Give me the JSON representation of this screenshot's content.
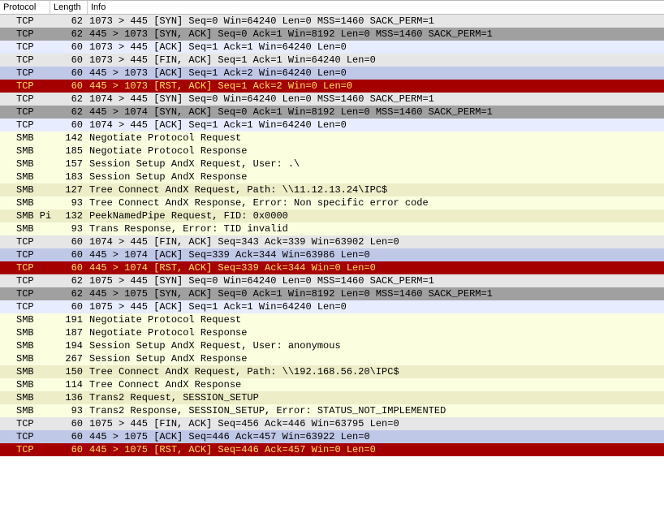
{
  "headers": {
    "protocol": "Protocol",
    "length": "Length",
    "info": "Info"
  },
  "rows": [
    {
      "cls": "gray1",
      "protocol": "TCP",
      "length": 62,
      "info": "1073 > 445 [SYN] Seq=0 Win=64240 Len=0 MSS=1460 SACK_PERM=1"
    },
    {
      "cls": "gray2",
      "protocol": "TCP",
      "length": 62,
      "info": "445 > 1073 [SYN, ACK] Seq=0 Ack=1 Win=8192 Len=0 MSS=1460 SACK_PERM=1"
    },
    {
      "cls": "blue1",
      "protocol": "TCP",
      "length": 60,
      "info": "1073 > 445 [ACK] Seq=1 Ack=1 Win=64240 Len=0"
    },
    {
      "cls": "gray1",
      "protocol": "TCP",
      "length": 60,
      "info": "1073 > 445 [FIN, ACK] Seq=1 Ack=1 Win=64240 Len=0"
    },
    {
      "cls": "blue2",
      "protocol": "TCP",
      "length": 60,
      "info": "445 > 1073 [ACK] Seq=1 Ack=2 Win=64240 Len=0"
    },
    {
      "cls": "red",
      "protocol": "TCP",
      "length": 60,
      "info": "445 > 1073 [RST, ACK] Seq=1 Ack=2 Win=0 Len=0"
    },
    {
      "cls": "gray1",
      "protocol": "TCP",
      "length": 62,
      "info": "1074 > 445 [SYN] Seq=0 Win=64240 Len=0 MSS=1460 SACK_PERM=1"
    },
    {
      "cls": "gray2",
      "protocol": "TCP",
      "length": 62,
      "info": "445 > 1074 [SYN, ACK] Seq=0 Ack=1 Win=8192 Len=0 MSS=1460 SACK_PERM=1"
    },
    {
      "cls": "blue1",
      "protocol": "TCP",
      "length": 60,
      "info": "1074 > 445 [ACK] Seq=1 Ack=1 Win=64240 Len=0"
    },
    {
      "cls": "yel1",
      "protocol": "SMB",
      "length": 142,
      "info": "Negotiate Protocol Request"
    },
    {
      "cls": "yel1",
      "protocol": "SMB",
      "length": 185,
      "info": "Negotiate Protocol Response"
    },
    {
      "cls": "yel1",
      "protocol": "SMB",
      "length": 157,
      "info": "Session Setup AndX Request, User: .\\"
    },
    {
      "cls": "yel1",
      "protocol": "SMB",
      "length": 183,
      "info": "Session Setup AndX Response"
    },
    {
      "cls": "yel2",
      "protocol": "SMB",
      "length": 127,
      "info": "Tree Connect AndX Request, Path: \\\\11.12.13.24\\IPC$"
    },
    {
      "cls": "yel1",
      "protocol": "SMB",
      "length": 93,
      "info": "Tree Connect AndX Response, Error: Non specific error code"
    },
    {
      "cls": "yel2",
      "protocol": "SMB Pi",
      "length": 132,
      "info": "PeekNamedPipe Request, FID: 0x0000"
    },
    {
      "cls": "yel1",
      "protocol": "SMB",
      "length": 93,
      "info": "Trans Response, Error: TID invalid"
    },
    {
      "cls": "gray1",
      "protocol": "TCP",
      "length": 60,
      "info": "1074 > 445 [FIN, ACK] Seq=343 Ack=339 Win=63902 Len=0"
    },
    {
      "cls": "blue2",
      "protocol": "TCP",
      "length": 60,
      "info": "445 > 1074 [ACK] Seq=339 Ack=344 Win=63986 Len=0"
    },
    {
      "cls": "red",
      "protocol": "TCP",
      "length": 60,
      "info": "445 > 1074 [RST, ACK] Seq=339 Ack=344 Win=0 Len=0"
    },
    {
      "cls": "gray1",
      "protocol": "TCP",
      "length": 62,
      "info": "1075 > 445 [SYN] Seq=0 Win=64240 Len=0 MSS=1460 SACK_PERM=1"
    },
    {
      "cls": "gray2",
      "protocol": "TCP",
      "length": 62,
      "info": "445 > 1075 [SYN, ACK] Seq=0 Ack=1 Win=8192 Len=0 MSS=1460 SACK_PERM=1"
    },
    {
      "cls": "blue1",
      "protocol": "TCP",
      "length": 60,
      "info": "1075 > 445 [ACK] Seq=1 Ack=1 Win=64240 Len=0"
    },
    {
      "cls": "yel1",
      "protocol": "SMB",
      "length": 191,
      "info": "Negotiate Protocol Request"
    },
    {
      "cls": "yel1",
      "protocol": "SMB",
      "length": 187,
      "info": "Negotiate Protocol Response"
    },
    {
      "cls": "yel1",
      "protocol": "SMB",
      "length": 194,
      "info": "Session Setup AndX Request, User: anonymous"
    },
    {
      "cls": "yel1",
      "protocol": "SMB",
      "length": 267,
      "info": "Session Setup AndX Response"
    },
    {
      "cls": "yel2",
      "protocol": "SMB",
      "length": 150,
      "info": "Tree Connect AndX Request, Path: \\\\192.168.56.20\\IPC$"
    },
    {
      "cls": "yel1",
      "protocol": "SMB",
      "length": 114,
      "info": "Tree Connect AndX Response"
    },
    {
      "cls": "yel2",
      "protocol": "SMB",
      "length": 136,
      "info": "Trans2 Request, SESSION_SETUP"
    },
    {
      "cls": "yel1",
      "protocol": "SMB",
      "length": 93,
      "info": "Trans2 Response, SESSION_SETUP, Error: STATUS_NOT_IMPLEMENTED"
    },
    {
      "cls": "gray1",
      "protocol": "TCP",
      "length": 60,
      "info": "1075 > 445 [FIN, ACK] Seq=456 Ack=446 Win=63795 Len=0"
    },
    {
      "cls": "blue2",
      "protocol": "TCP",
      "length": 60,
      "info": "445 > 1075 [ACK] Seq=446 Ack=457 Win=63922 Len=0"
    },
    {
      "cls": "red",
      "protocol": "TCP",
      "length": 60,
      "info": "445 > 1075 [RST, ACK] Seq=446 Ack=457 Win=0 Len=0"
    }
  ]
}
